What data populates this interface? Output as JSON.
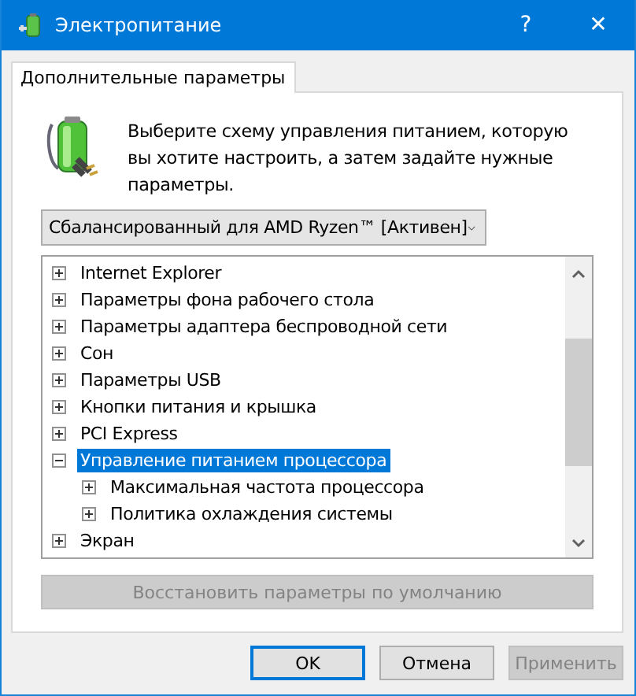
{
  "window": {
    "title": "Электропитание",
    "buttons": [
      "?",
      "✕"
    ]
  },
  "tabs": [
    {
      "label": "Дополнительные параметры",
      "selected": true
    }
  ],
  "description": "Выберите схему управления питанием, которую вы хотите настроить, а затем задайте нужные параметры.",
  "plan_dropdown": {
    "value": "Сбалансированный для AMD Ryzen™ [Активен]"
  },
  "tree": [
    {
      "label": "Internet Explorer",
      "expanded": false,
      "selected": false
    },
    {
      "label": "Параметры фона рабочего стола",
      "expanded": false,
      "selected": false
    },
    {
      "label": "Параметры адаптера беспроводной сети",
      "expanded": false,
      "selected": false
    },
    {
      "label": "Сон",
      "expanded": false,
      "selected": false
    },
    {
      "label": "Параметры USB",
      "expanded": false,
      "selected": false
    },
    {
      "label": "Кнопки питания и крышка",
      "expanded": false,
      "selected": false
    },
    {
      "label": "PCI Express",
      "expanded": false,
      "selected": false
    },
    {
      "label": "Управление питанием процессора",
      "expanded": true,
      "selected": true,
      "children": [
        {
          "label": "Максимальная частота процессора",
          "expanded": false,
          "selected": false
        },
        {
          "label": "Политика охлаждения системы",
          "expanded": false,
          "selected": false
        }
      ]
    },
    {
      "label": "Экран",
      "expanded": false,
      "selected": false
    }
  ],
  "restore_button": {
    "label": "Восстановить параметры по умолчанию",
    "disabled": true
  },
  "buttons": [
    {
      "label": "OK",
      "default": true,
      "disabled": false
    },
    {
      "label": "Отмена",
      "default": false,
      "disabled": false
    },
    {
      "label": "Применить",
      "default": false,
      "disabled": true
    }
  ]
}
